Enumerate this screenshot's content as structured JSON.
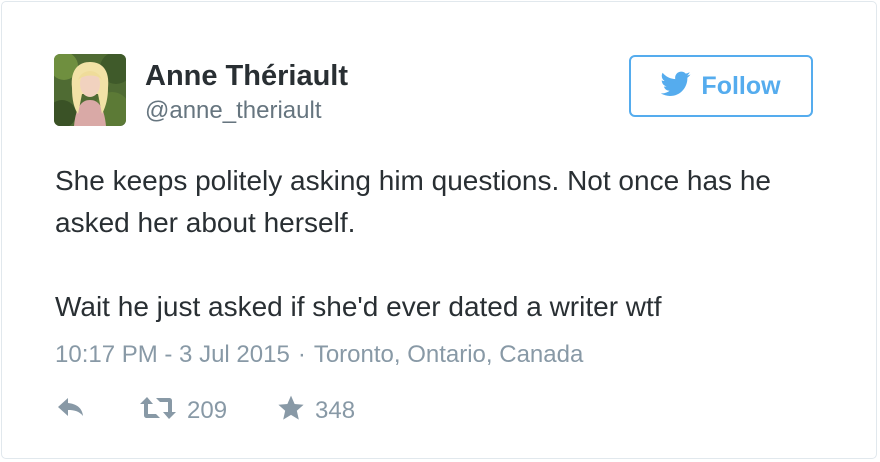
{
  "user": {
    "name": "Anne Thériault",
    "handle": "@anne_theriault"
  },
  "follow_button": {
    "label": "Follow",
    "icon": "twitter-bird-icon",
    "color": "#55acee"
  },
  "tweet": {
    "paragraphs": [
      "She keeps politely asking him questions. Not once has he asked her about herself.",
      "Wait he just asked if she'd ever dated a writer wtf"
    ],
    "timestamp": "10:17 PM - 3 Jul 2015",
    "separator": "·",
    "location": "Toronto, Ontario, Canada"
  },
  "actions": {
    "reply": {
      "icon": "reply-icon"
    },
    "retweet": {
      "icon": "retweet-icon",
      "count": "209"
    },
    "favorite": {
      "icon": "star-icon",
      "count": "348"
    }
  },
  "colors": {
    "text": "#292f33",
    "secondary": "#8899a6",
    "accent": "#55acee"
  }
}
